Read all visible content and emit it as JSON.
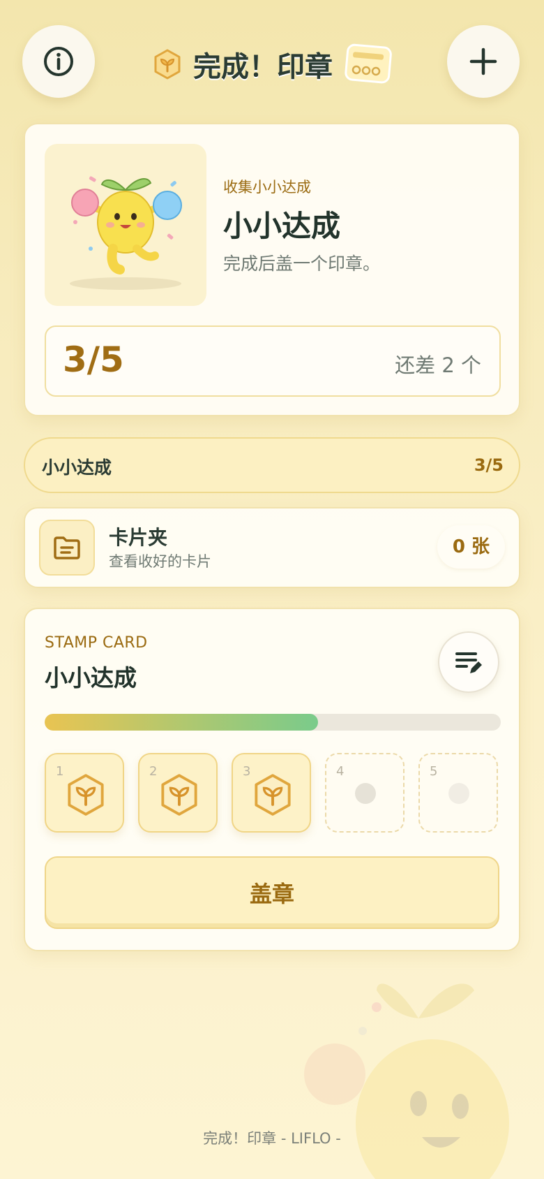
{
  "header": {
    "title": "完成！印章"
  },
  "hero": {
    "caption": "收集小小达成",
    "title": "小小达成",
    "description": "完成后盖一个印章。",
    "progress_text": "3/5",
    "remaining_text": "还差 2 个"
  },
  "selector": {
    "label": "小小达成",
    "count": "3/5"
  },
  "card_folder": {
    "title": "卡片夹",
    "subtitle": "查看收好的卡片",
    "count_badge": "0 张"
  },
  "stamp_card": {
    "overline": "STAMP CARD",
    "title": "小小达成",
    "progress_fraction": 0.6,
    "slots": [
      {
        "number": "1",
        "stamped": true
      },
      {
        "number": "2",
        "stamped": true
      },
      {
        "number": "3",
        "stamped": true
      },
      {
        "number": "4",
        "stamped": false
      },
      {
        "number": "5",
        "stamped": false
      }
    ],
    "stamp_button_label": "盖章"
  },
  "footer": {
    "text": "完成！印章 - LIFLO -"
  },
  "colors": {
    "accent_brown": "#9a6a10",
    "dark_green": "#2a3b33",
    "progress_start": "#e9c452",
    "progress_end": "#7acb8b"
  },
  "icons": [
    "info-icon",
    "plus-icon",
    "seed-hexagon-icon",
    "stamp-card-icon",
    "folder-icon",
    "edit-list-icon",
    "mascot-illustration"
  ]
}
